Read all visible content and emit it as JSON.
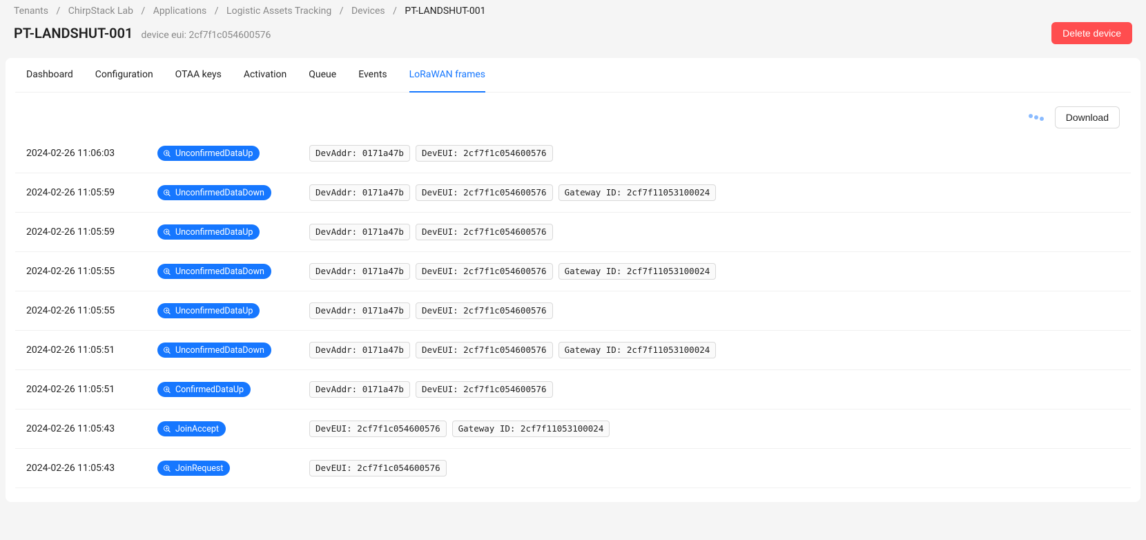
{
  "breadcrumb": {
    "items": [
      {
        "label": "Tenants"
      },
      {
        "label": "ChirpStack Lab"
      },
      {
        "label": "Applications"
      },
      {
        "label": "Logistic Assets Tracking"
      },
      {
        "label": "Devices"
      },
      {
        "label": "PT-LANDSHUT-001"
      }
    ],
    "sep": "/"
  },
  "header": {
    "title": "PT-LANDSHUT-001",
    "subtitle": "device eui: 2cf7f1c054600576",
    "delete_label": "Delete device"
  },
  "tabs": [
    {
      "label": "Dashboard",
      "active": false
    },
    {
      "label": "Configuration",
      "active": false
    },
    {
      "label": "OTAA keys",
      "active": false
    },
    {
      "label": "Activation",
      "active": false
    },
    {
      "label": "Queue",
      "active": false
    },
    {
      "label": "Events",
      "active": false
    },
    {
      "label": "LoRaWAN frames",
      "active": true
    }
  ],
  "toolbar": {
    "download_label": "Download"
  },
  "frames": [
    {
      "time": "2024-02-26 11:06:03",
      "type": "UnconfirmedDataUp",
      "tags": [
        "DevAddr: 0171a47b",
        "DevEUI: 2cf7f1c054600576"
      ]
    },
    {
      "time": "2024-02-26 11:05:59",
      "type": "UnconfirmedDataDown",
      "tags": [
        "DevAddr: 0171a47b",
        "DevEUI: 2cf7f1c054600576",
        "Gateway ID: 2cf7f11053100024"
      ]
    },
    {
      "time": "2024-02-26 11:05:59",
      "type": "UnconfirmedDataUp",
      "tags": [
        "DevAddr: 0171a47b",
        "DevEUI: 2cf7f1c054600576"
      ]
    },
    {
      "time": "2024-02-26 11:05:55",
      "type": "UnconfirmedDataDown",
      "tags": [
        "DevAddr: 0171a47b",
        "DevEUI: 2cf7f1c054600576",
        "Gateway ID: 2cf7f11053100024"
      ]
    },
    {
      "time": "2024-02-26 11:05:55",
      "type": "UnconfirmedDataUp",
      "tags": [
        "DevAddr: 0171a47b",
        "DevEUI: 2cf7f1c054600576"
      ]
    },
    {
      "time": "2024-02-26 11:05:51",
      "type": "UnconfirmedDataDown",
      "tags": [
        "DevAddr: 0171a47b",
        "DevEUI: 2cf7f1c054600576",
        "Gateway ID: 2cf7f11053100024"
      ]
    },
    {
      "time": "2024-02-26 11:05:51",
      "type": "ConfirmedDataUp",
      "tags": [
        "DevAddr: 0171a47b",
        "DevEUI: 2cf7f1c054600576"
      ]
    },
    {
      "time": "2024-02-26 11:05:43",
      "type": "JoinAccept",
      "tags": [
        "DevEUI: 2cf7f1c054600576",
        "Gateway ID: 2cf7f11053100024"
      ]
    },
    {
      "time": "2024-02-26 11:05:43",
      "type": "JoinRequest",
      "tags": [
        "DevEUI: 2cf7f1c054600576"
      ]
    }
  ]
}
